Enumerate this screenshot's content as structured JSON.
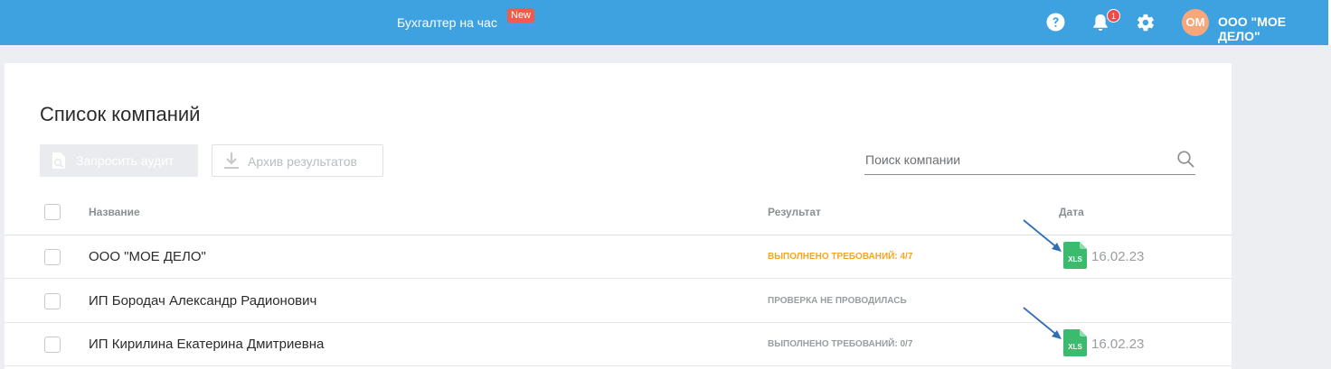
{
  "header": {
    "nav_link": "Бухгалтер на час",
    "new_badge": "New",
    "notifications_count": "1",
    "avatar_initials": "ОМ",
    "org_name": "ООО \"МОЕ ДЕЛО\""
  },
  "page": {
    "title": "Список компаний",
    "request_audit_label": "Запросить аудит",
    "archive_label": "Архив результатов",
    "search_placeholder": "Поиск компании"
  },
  "table": {
    "columns": [
      "Название",
      "Результат",
      "Дата"
    ],
    "rows": [
      {
        "name": "ООО \"МОЕ ДЕЛО\"",
        "result": "Выполнено требований: 4/7",
        "result_color": "#f5a623",
        "file_type": "XLS",
        "date": "16.02.23"
      },
      {
        "name": "ИП Бородач Александр Радионович",
        "result": "Проверка не проводилась",
        "result_color": "#9a9da1",
        "file_type": "",
        "date": ""
      },
      {
        "name": "ИП Кирилина Екатерина Дмитриевна",
        "result": "Выполнено требований: 0/7",
        "result_color": "#9a9da1",
        "file_type": "XLS",
        "date": "16.02.23"
      }
    ]
  },
  "colors": {
    "header_bg": "#3ea2e0",
    "badge_new": "#f15b4d",
    "avatar_bg": "#f7a77b",
    "xls_green": "#3bbb6e",
    "annotation_arrow": "#2f6fb3"
  },
  "icons": [
    "help-icon",
    "bell-icon",
    "gear-icon",
    "search-icon",
    "audit-icon",
    "download-icon",
    "xls-file-icon"
  ]
}
